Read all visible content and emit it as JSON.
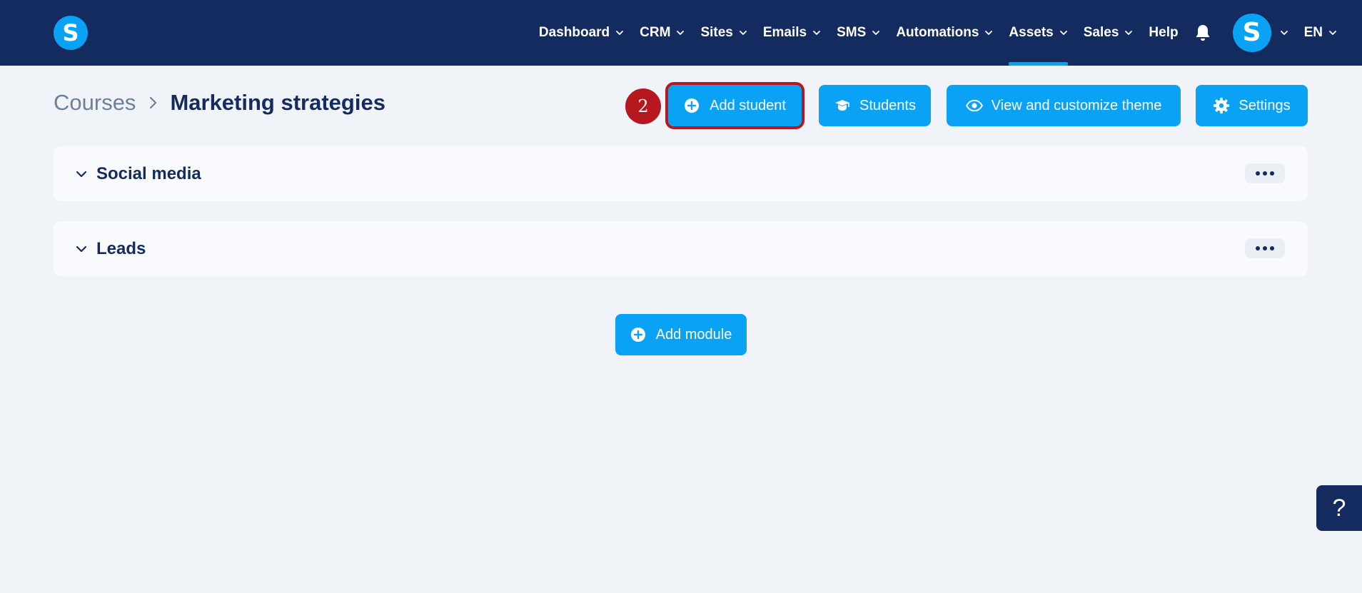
{
  "logo": {
    "letter": "S"
  },
  "nav": {
    "items": [
      {
        "label": "Dashboard",
        "dropdown": true
      },
      {
        "label": "CRM",
        "dropdown": true
      },
      {
        "label": "Sites",
        "dropdown": true
      },
      {
        "label": "Emails",
        "dropdown": true
      },
      {
        "label": "SMS",
        "dropdown": true
      },
      {
        "label": "Automations",
        "dropdown": true
      },
      {
        "label": "Assets",
        "dropdown": true,
        "active": true
      },
      {
        "label": "Sales",
        "dropdown": true
      },
      {
        "label": "Help",
        "dropdown": false
      }
    ],
    "avatar_letter": "S",
    "language": "EN"
  },
  "breadcrumb": {
    "parent": "Courses",
    "current": "Marketing strategies"
  },
  "actions": {
    "step_number": "2",
    "add_student": "Add student",
    "students": "Students",
    "view_theme": "View and customize theme",
    "settings": "Settings"
  },
  "modules": [
    {
      "title": "Social media"
    },
    {
      "title": "Leads"
    }
  ],
  "add_module": "Add module",
  "help_fab": "?",
  "colors": {
    "navbar": "#142b5f",
    "accent": "#0aa2f5",
    "highlight": "#b5181f",
    "background": "#f0f4f9"
  }
}
